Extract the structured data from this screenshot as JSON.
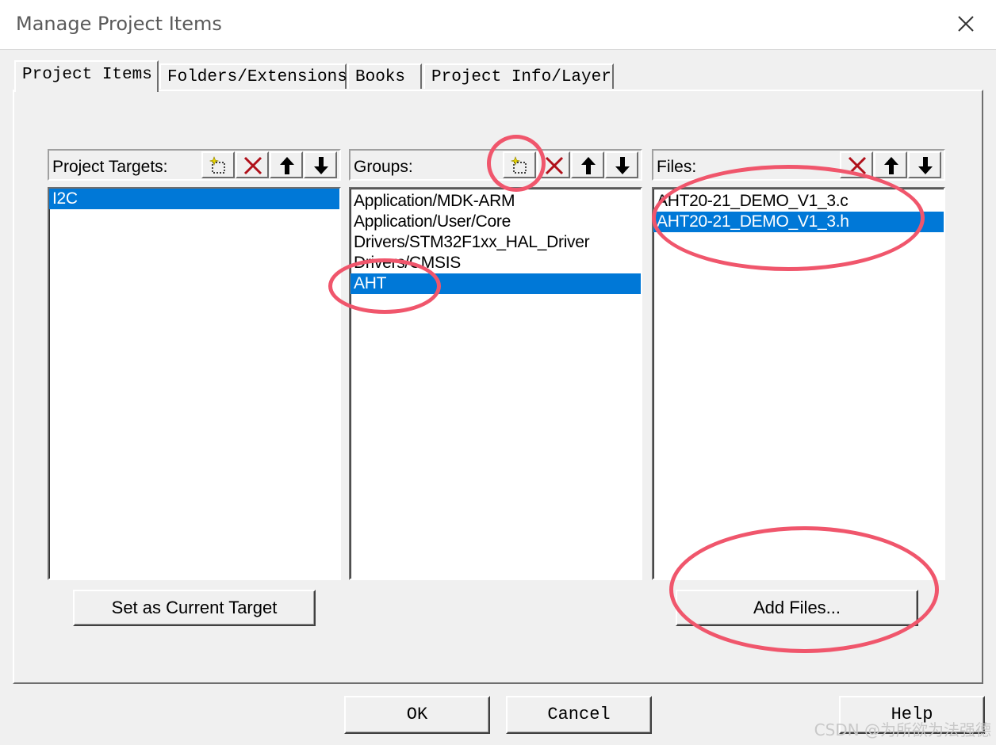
{
  "window": {
    "title": "Manage Project Items"
  },
  "tabs": [
    {
      "label": "Project Items",
      "active": true
    },
    {
      "label": "Folders/Extensions",
      "active": false
    },
    {
      "label": "Books",
      "active": false
    },
    {
      "label": "Project Info/Layer",
      "active": false
    }
  ],
  "targets": {
    "label": "Project Targets:",
    "items": [
      {
        "label": "I2C",
        "selected": true
      }
    ],
    "set_current_label": "Set as Current Target"
  },
  "groups": {
    "label": "Groups:",
    "items": [
      {
        "label": "Application/MDK-ARM",
        "selected": false
      },
      {
        "label": "Application/User/Core",
        "selected": false
      },
      {
        "label": "Drivers/STM32F1xx_HAL_Driver",
        "selected": false
      },
      {
        "label": "Drivers/CMSIS",
        "selected": false
      },
      {
        "label": "AHT",
        "selected": true
      }
    ]
  },
  "files": {
    "label": "Files:",
    "items": [
      {
        "label": "AHT20-21_DEMO_V1_3.c",
        "selected": false
      },
      {
        "label": "AHT20-21_DEMO_V1_3.h",
        "selected": true
      }
    ],
    "add_files_label": "Add Files..."
  },
  "footer": {
    "ok_label": "OK",
    "cancel_label": "Cancel",
    "help_label": "Help"
  },
  "watermark": "CSDN @为所欲为法强德",
  "colors": {
    "selection": "#0078d7",
    "annotation": "#f0566c"
  }
}
